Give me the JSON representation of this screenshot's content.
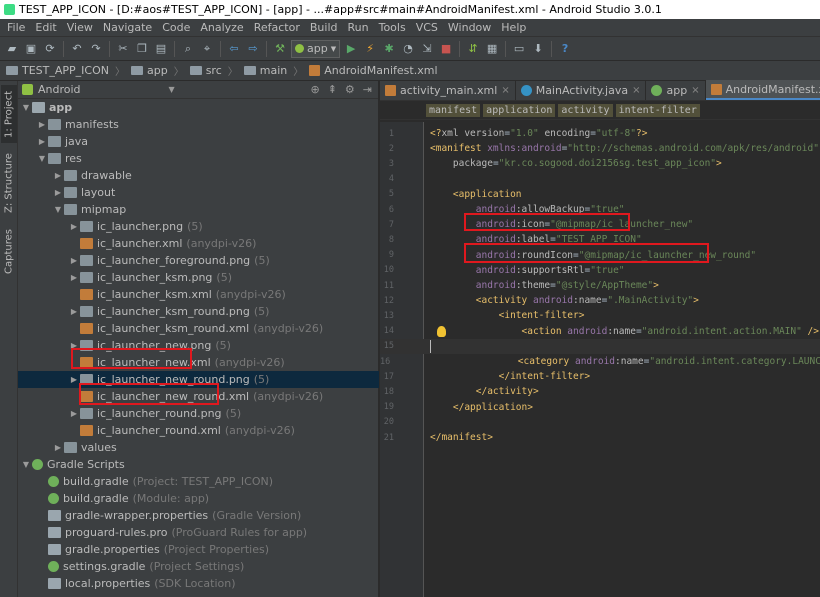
{
  "window": {
    "title": "TEST_APP_ICON - [D:#aos#TEST_APP_ICON] - [app] - ...#app#src#main#AndroidManifest.xml - Android Studio 3.0.1"
  },
  "menu": [
    "File",
    "Edit",
    "View",
    "Navigate",
    "Code",
    "Analyze",
    "Refactor",
    "Build",
    "Run",
    "Tools",
    "VCS",
    "Window",
    "Help"
  ],
  "toolbar": {
    "run_config": "app"
  },
  "breadcrumb": [
    "TEST_APP_ICON",
    "app",
    "src",
    "main",
    "AndroidManifest.xml"
  ],
  "left_strip": {
    "project_tab": "1: Project",
    "structure_tab": "Z: Structure",
    "captures_tab": "Captures"
  },
  "project_panel": {
    "view_mode": "Android",
    "tree": [
      {
        "indent": 0,
        "arrow": "▼",
        "icon": "modfolder",
        "label": "app",
        "extra": "",
        "bold": true
      },
      {
        "indent": 1,
        "arrow": "▶",
        "icon": "folder",
        "label": "manifests",
        "extra": ""
      },
      {
        "indent": 1,
        "arrow": "▶",
        "icon": "folder",
        "label": "java",
        "extra": ""
      },
      {
        "indent": 1,
        "arrow": "▼",
        "icon": "res",
        "label": "res",
        "extra": ""
      },
      {
        "indent": 2,
        "arrow": "▶",
        "icon": "folder",
        "label": "drawable",
        "extra": ""
      },
      {
        "indent": 2,
        "arrow": "▶",
        "icon": "folder",
        "label": "layout",
        "extra": ""
      },
      {
        "indent": 2,
        "arrow": "▼",
        "icon": "folder",
        "label": "mipmap",
        "extra": ""
      },
      {
        "indent": 3,
        "arrow": "▶",
        "icon": "folder",
        "label": "ic_launcher.png",
        "extra": "(5)"
      },
      {
        "indent": 3,
        "arrow": "",
        "icon": "xml",
        "label": "ic_launcher.xml",
        "extra": "(anydpi-v26)"
      },
      {
        "indent": 3,
        "arrow": "▶",
        "icon": "folder",
        "label": "ic_launcher_foreground.png",
        "extra": "(5)"
      },
      {
        "indent": 3,
        "arrow": "▶",
        "icon": "folder",
        "label": "ic_launcher_ksm.png",
        "extra": "(5)"
      },
      {
        "indent": 3,
        "arrow": "",
        "icon": "xml",
        "label": "ic_launcher_ksm.xml",
        "extra": "(anydpi-v26)"
      },
      {
        "indent": 3,
        "arrow": "▶",
        "icon": "folder",
        "label": "ic_launcher_ksm_round.png",
        "extra": "(5)"
      },
      {
        "indent": 3,
        "arrow": "",
        "icon": "xml",
        "label": "ic_launcher_ksm_round.xml",
        "extra": "(anydpi-v26)"
      },
      {
        "indent": 3,
        "arrow": "▶",
        "icon": "folder",
        "label": "ic_launcher_new.png",
        "extra": "(5)"
      },
      {
        "indent": 3,
        "arrow": "",
        "icon": "xml",
        "label": "ic_launcher_new.xml",
        "extra": "(anydpi-v26)"
      },
      {
        "indent": 3,
        "arrow": "▶",
        "icon": "folder",
        "label": "ic_launcher_new_round.png",
        "extra": "(5)",
        "selected": true
      },
      {
        "indent": 3,
        "arrow": "",
        "icon": "xml",
        "label": "ic_launcher_new_round.xml",
        "extra": "(anydpi-v26)"
      },
      {
        "indent": 3,
        "arrow": "▶",
        "icon": "folder",
        "label": "ic_launcher_round.png",
        "extra": "(5)"
      },
      {
        "indent": 3,
        "arrow": "",
        "icon": "xml",
        "label": "ic_launcher_round.xml",
        "extra": "(anydpi-v26)"
      },
      {
        "indent": 2,
        "arrow": "▶",
        "icon": "folder",
        "label": "values",
        "extra": ""
      },
      {
        "indent": 0,
        "arrow": "▼",
        "icon": "gradle",
        "label": "Gradle Scripts",
        "extra": ""
      },
      {
        "indent": 1,
        "arrow": "",
        "icon": "gradle",
        "label": "build.gradle",
        "extra": "(Project: TEST_APP_ICON)"
      },
      {
        "indent": 1,
        "arrow": "",
        "icon": "gradle",
        "label": "build.gradle",
        "extra": "(Module: app)"
      },
      {
        "indent": 1,
        "arrow": "",
        "icon": "file",
        "label": "gradle-wrapper.properties",
        "extra": "(Gradle Version)"
      },
      {
        "indent": 1,
        "arrow": "",
        "icon": "file",
        "label": "proguard-rules.pro",
        "extra": "(ProGuard Rules for app)"
      },
      {
        "indent": 1,
        "arrow": "",
        "icon": "file",
        "label": "gradle.properties",
        "extra": "(Project Properties)"
      },
      {
        "indent": 1,
        "arrow": "",
        "icon": "gradle",
        "label": "settings.gradle",
        "extra": "(Project Settings)"
      },
      {
        "indent": 1,
        "arrow": "",
        "icon": "file",
        "label": "local.properties",
        "extra": "(SDK Location)"
      }
    ]
  },
  "editor": {
    "tabs": [
      {
        "label": "activity_main.xml",
        "icon": "xml",
        "active": false
      },
      {
        "label": "MainActivity.java",
        "icon": "class",
        "active": false
      },
      {
        "label": "app",
        "icon": "gradle",
        "active": false
      },
      {
        "label": "AndroidManifest.xml",
        "icon": "xml",
        "active": true
      }
    ],
    "xml_breadcrumbs": [
      "manifest",
      "application",
      "activity",
      "intent-filter"
    ],
    "lines": [
      [
        [
          "t-pi",
          "<?"
        ],
        [
          "t-attr",
          "xml version"
        ],
        [
          "t-plain",
          "="
        ],
        [
          "t-val",
          "\"1.0\""
        ],
        [
          "t-attr",
          " encoding"
        ],
        [
          "t-plain",
          "="
        ],
        [
          "t-val",
          "\"utf-8\""
        ],
        [
          "t-pi",
          "?>"
        ]
      ],
      [
        [
          "t-tag",
          "<manifest "
        ],
        [
          "t-ns",
          "xmlns:android"
        ],
        [
          "t-plain",
          "="
        ],
        [
          "t-val",
          "\"http://schemas.android.com/apk/res/android\""
        ]
      ],
      [
        [
          "t-plain",
          "    "
        ],
        [
          "t-attr",
          "package"
        ],
        [
          "t-plain",
          "="
        ],
        [
          "t-val",
          "\"kr.co.sogood.doi2156sg.test_app_icon\""
        ],
        [
          "t-tag",
          ">"
        ]
      ],
      [],
      [
        [
          "t-plain",
          "    "
        ],
        [
          "t-tag",
          "<application"
        ]
      ],
      [
        [
          "t-plain",
          "        "
        ],
        [
          "t-ns",
          "android"
        ],
        [
          "t-attr",
          ":allowBackup"
        ],
        [
          "t-plain",
          "="
        ],
        [
          "t-val",
          "\"true\""
        ]
      ],
      [
        [
          "t-plain",
          "        "
        ],
        [
          "t-ns",
          "android"
        ],
        [
          "t-attr",
          ":icon"
        ],
        [
          "t-plain",
          "="
        ],
        [
          "t-val",
          "\"@mipmap/ic_launcher_new\""
        ]
      ],
      [
        [
          "t-plain",
          "        "
        ],
        [
          "t-ns",
          "android"
        ],
        [
          "t-attr",
          ":label"
        ],
        [
          "t-plain",
          "="
        ],
        [
          "t-val",
          "\"TEST_APP_ICON\""
        ]
      ],
      [
        [
          "t-plain",
          "        "
        ],
        [
          "t-ns",
          "android"
        ],
        [
          "t-attr",
          ":roundIcon"
        ],
        [
          "t-plain",
          "="
        ],
        [
          "t-val",
          "\"@mipmap/ic_launcher_new_round\""
        ]
      ],
      [
        [
          "t-plain",
          "        "
        ],
        [
          "t-ns",
          "android"
        ],
        [
          "t-attr",
          ":supportsRtl"
        ],
        [
          "t-plain",
          "="
        ],
        [
          "t-val",
          "\"true\""
        ]
      ],
      [
        [
          "t-plain",
          "        "
        ],
        [
          "t-ns",
          "android"
        ],
        [
          "t-attr",
          ":theme"
        ],
        [
          "t-plain",
          "="
        ],
        [
          "t-val",
          "\"@style/AppTheme\""
        ],
        [
          "t-tag",
          ">"
        ]
      ],
      [
        [
          "t-plain",
          "        "
        ],
        [
          "t-tag",
          "<activity "
        ],
        [
          "t-ns",
          "android"
        ],
        [
          "t-attr",
          ":name"
        ],
        [
          "t-plain",
          "="
        ],
        [
          "t-val",
          "\".MainActivity\""
        ],
        [
          "t-tag",
          ">"
        ]
      ],
      [
        [
          "t-plain",
          "            "
        ],
        [
          "t-tag",
          "<intent-filter>"
        ]
      ],
      [
        [
          "t-plain",
          "                "
        ],
        [
          "t-tag",
          "<action "
        ],
        [
          "t-ns",
          "android"
        ],
        [
          "t-attr",
          ":name"
        ],
        [
          "t-plain",
          "="
        ],
        [
          "t-val",
          "\"android.intent.action.MAIN\""
        ],
        [
          "t-tag",
          " />"
        ]
      ],
      [],
      [
        [
          "t-plain",
          "                "
        ],
        [
          "t-tag",
          "<category "
        ],
        [
          "t-ns",
          "android"
        ],
        [
          "t-attr",
          ":name"
        ],
        [
          "t-plain",
          "="
        ],
        [
          "t-val",
          "\"android.intent.category.LAUNCHER\""
        ],
        [
          "t-tag",
          " />"
        ]
      ],
      [
        [
          "t-plain",
          "            "
        ],
        [
          "t-tag",
          "</intent-filter>"
        ]
      ],
      [
        [
          "t-plain",
          "        "
        ],
        [
          "t-tag",
          "</activity>"
        ]
      ],
      [
        [
          "t-plain",
          "    "
        ],
        [
          "t-tag",
          "</application>"
        ]
      ],
      [],
      [
        [
          "t-tag",
          "</manifest>"
        ]
      ]
    ]
  },
  "colors": {
    "highlight_box": "#e0181e",
    "selection": "#0d293e",
    "accent": "#4a88c7"
  }
}
